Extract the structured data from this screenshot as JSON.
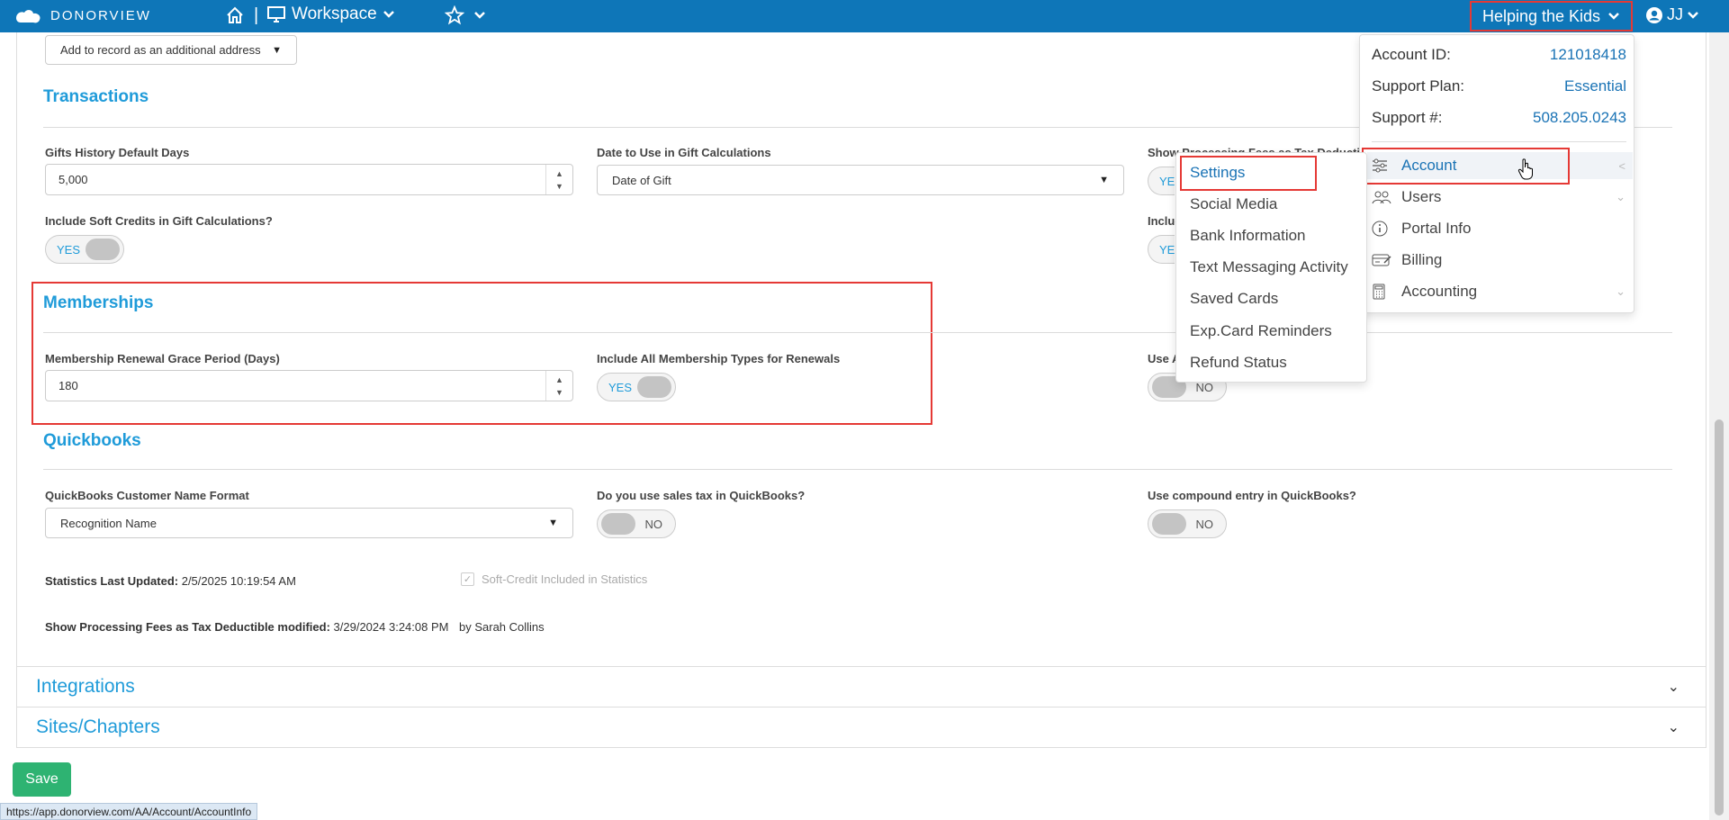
{
  "topbar": {
    "logo_text": "DONORVIEW",
    "workspace_label": "Workspace",
    "separator": "|",
    "org_name": "Helping the Kids",
    "user_initials": "JJ"
  },
  "top_select": {
    "value": "Add to record as an additional address"
  },
  "transactions": {
    "title": "Transactions",
    "gifts_history_label": "Gifts History Default Days",
    "gifts_history_value": "5,000",
    "date_calc_label": "Date to Use in Gift Calculations",
    "date_calc_value": "Date of Gift",
    "processing_fees_label": "Show Processing Fees as Tax Deductible",
    "processing_fees_toggle": "YES",
    "soft_credits_label": "Include Soft Credits in Gift Calculations?",
    "soft_credits_toggle": "YES",
    "right_label_2": "Includ",
    "right_toggle_2": "YES"
  },
  "memberships": {
    "title": "Memberships",
    "grace_label": "Membership Renewal Grace Period (Days)",
    "grace_value": "180",
    "include_all_label": "Include All Membership Types for Renewals",
    "include_all_toggle": "YES",
    "right_label": "Use A",
    "right_toggle": "NO"
  },
  "quickbooks": {
    "title": "Quickbooks",
    "name_format_label": "QuickBooks Customer Name Format",
    "name_format_value": "Recognition Name",
    "sales_tax_label": "Do you use sales tax in QuickBooks?",
    "sales_tax_toggle": "NO",
    "compound_label": "Use compound entry in QuickBooks?",
    "compound_toggle": "NO"
  },
  "stats": {
    "updated_label": "Statistics Last Updated:",
    "updated_value": "2/5/2025 10:19:54 AM",
    "soft_credit_label": "Soft-Credit Included in Statistics",
    "fees_modified_label": "Show Processing Fees as Tax Deductible modified:",
    "fees_modified_value": "3/29/2024 3:24:08 PM",
    "modified_by": "by Sarah Collins"
  },
  "accordions": [
    {
      "title": "Integrations"
    },
    {
      "title": "Sites/Chapters"
    }
  ],
  "save_label": "Save",
  "status_url": "https://app.donorview.com/AA/Account/AccountInfo",
  "account_panel": {
    "account_id_label": "Account ID:",
    "account_id_value": "121018418",
    "support_plan_label": "Support Plan:",
    "support_plan_value": "Essential",
    "support_num_label": "Support #:",
    "support_num_value": "508.205.0243",
    "menu": [
      {
        "label": "Account",
        "icon": "sliders-icon"
      },
      {
        "label": "Users",
        "icon": "users-icon"
      },
      {
        "label": "Portal Info",
        "icon": "info-icon"
      },
      {
        "label": "Billing",
        "icon": "billing-icon"
      },
      {
        "label": "Accounting",
        "icon": "calculator-icon"
      }
    ]
  },
  "account_submenu": [
    {
      "label": "Settings"
    },
    {
      "label": "Social Media"
    },
    {
      "label": "Bank Information"
    },
    {
      "label": "Text Messaging Activity"
    },
    {
      "label": "Saved Cards"
    },
    {
      "label": "Exp.Card Reminders"
    },
    {
      "label": "Refund Status"
    }
  ],
  "colors": {
    "nav_bg": "#0e76b8",
    "accent": "#1f9bd9",
    "highlight_box": "#e53935",
    "save_green": "#2eb372"
  }
}
